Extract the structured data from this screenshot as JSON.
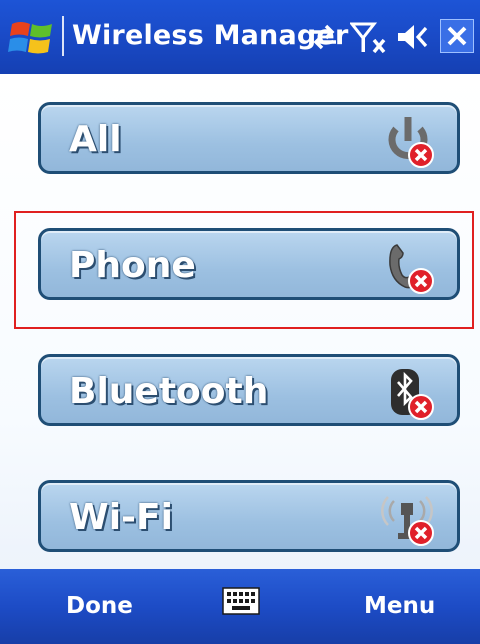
{
  "title_bar": {
    "title": "Wireless Manager",
    "icons": [
      "windows-start-icon",
      "connectivity-icon",
      "signal-off-icon",
      "volume-icon",
      "close-icon"
    ]
  },
  "radios": [
    {
      "label": "All",
      "icon": "power-off-icon",
      "state": "off"
    },
    {
      "label": "Phone",
      "icon": "phone-off-icon",
      "state": "off"
    },
    {
      "label": "Bluetooth",
      "icon": "bluetooth-off-icon",
      "state": "off"
    },
    {
      "label": "Wi-Fi",
      "icon": "wifi-off-icon",
      "state": "off"
    }
  ],
  "selected_radio": "Phone",
  "softkeys": {
    "left": "Done",
    "right": "Menu",
    "center_icon": "keyboard-icon"
  },
  "colors": {
    "title_bar": "#1a4bc8",
    "button_fill": "#9cc0e1",
    "button_border": "#1f4e76",
    "focus": "#e02020",
    "off_badge": "#e0202a"
  }
}
